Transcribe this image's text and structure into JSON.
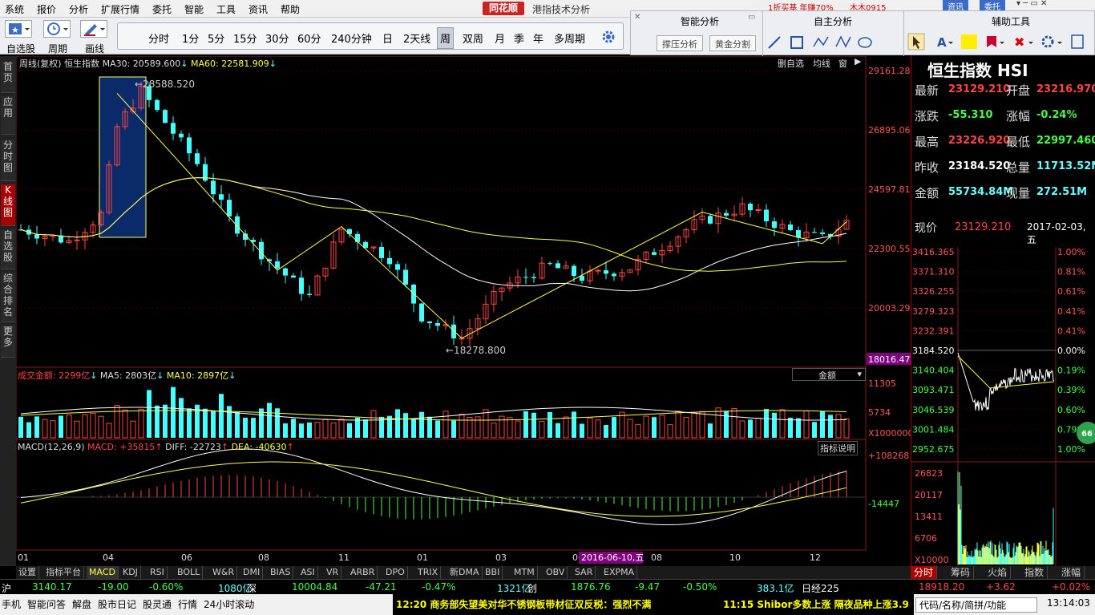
{
  "menu": [
    "系统",
    "报价",
    "分析",
    "扩展行情",
    "委托",
    "智能",
    "工具",
    "资讯",
    "帮助"
  ],
  "brand": "同花顺",
  "app_title": "港指技术分析",
  "top_right": {
    "ad": "1折买基 年赚70%",
    "user": "木木0915",
    "btn1": "资讯",
    "btn2": "委托"
  },
  "toolbar": {
    "btn_labels": [
      "自选股",
      "周期",
      "画线"
    ],
    "periods": [
      "分时",
      "1分",
      "5分",
      "15分",
      "30分",
      "60分",
      "240分钟",
      "日",
      "2天线",
      "周",
      "双周",
      "月",
      "季",
      "年",
      "多周期"
    ],
    "selected_period": "周"
  },
  "palettes": {
    "smart_title": "智能分析",
    "smart_btn1": "撑压分析",
    "smart_btn2": "黄金分割",
    "self_title": "自主分析",
    "aux_title": "辅助工具"
  },
  "leftnav": [
    "首页",
    "应用",
    "分时图",
    "K线图",
    "自选股",
    "综合排名",
    "更多"
  ],
  "main": {
    "hdr_period": "周线(复权)",
    "hdr_name": "恒生指数",
    "ma30": "MA30: 20589.600",
    "ma60": "MA60: 22581.909",
    "buttons": [
      "删自选",
      "均线",
      "窗"
    ],
    "price_axis": [
      "29161.28",
      "26895.06",
      "24597.81",
      "22300.55",
      "20003.29",
      "18016.47"
    ],
    "high_label": "28588.520",
    "low_label": "18278.800",
    "vol_hdr": "成交金额: 2299亿",
    "vol_ma5": "MA5: 2803亿",
    "vol_ma10": "MA10: 2897亿",
    "vol_select": "金额",
    "vol_axis": [
      "11305",
      "5734",
      "X1000000"
    ],
    "macd_hdr": "MACD(12,26,9)",
    "macd_val": "MACD: +35815",
    "diff": "DIFF: -22723",
    "dea": "DEA: -40630",
    "macd_btn": "指标说明",
    "macd_axis": [
      "+108268",
      "-14447"
    ],
    "x_axis": [
      "01",
      "04",
      "06",
      "08",
      "11",
      "01",
      "03",
      "06",
      "08",
      "10",
      "12"
    ],
    "cursor_date": "2016-06-10,五"
  },
  "idx_tabs": [
    "设置",
    "指标平台",
    "MACD",
    "KDJ",
    "RSI",
    "BOLL",
    "W&R",
    "DMI",
    "BIAS",
    "ASI",
    "VR",
    "ARBR",
    "DPO",
    "TRIX",
    "新DMA",
    "BBI",
    "MTM",
    "OBV",
    "SAR",
    "EXPMA"
  ],
  "idx_tab_active": "MACD",
  "panel": {
    "name": "恒生指数 HSI",
    "rows": [
      {
        "l1": "最新",
        "v1": "23129.210",
        "c1": "r",
        "l2": "开盘",
        "v2": "23216.970",
        "c2": "r"
      },
      {
        "l1": "涨跌",
        "v1": "-55.310",
        "c1": "g",
        "l2": "涨幅",
        "v2": "-0.24%",
        "c2": "g"
      },
      {
        "l1": "最高",
        "v1": "23226.920",
        "c1": "r",
        "l2": "最低",
        "v2": "22997.460",
        "c2": "g"
      },
      {
        "l1": "昨收",
        "v1": "23184.520",
        "c1": "w",
        "l2": "总量",
        "v2": "11713.52M",
        "c2": "c"
      },
      {
        "l1": "金额",
        "v1": "55734.84M",
        "c1": "c",
        "l2": "现量",
        "v2": "272.51M",
        "c2": "c"
      }
    ],
    "now_label": "现价",
    "now_val": "23129.210",
    "now_date": "2017-02-03,五",
    "mini_left": [
      "3416.365",
      "3371.310",
      "3326.255",
      "3279.323",
      "3232.391",
      "3184.520",
      "3140.404",
      "3093.471",
      "3046.539",
      "3001.484",
      "2952.675"
    ],
    "mini_right": [
      "1.00%",
      "0.81%",
      "0.61%",
      "0.41%",
      "0.41%",
      "0.00%",
      "0.19%",
      "0.39%",
      "0.60%",
      "0.79%",
      "1.00%"
    ],
    "mini_vol": [
      "26823",
      "20117",
      "13411",
      "6706",
      "X10000"
    ],
    "badge": "66",
    "tabs": [
      "分时",
      "筹码",
      "火焰",
      "指数",
      "涨幅"
    ]
  },
  "market": {
    "sh": "沪",
    "sh_v": "3140.17",
    "sh_c": "-19.00",
    "sh_p": "-0.60%",
    "sh_amt": "1080亿",
    "sz": "深",
    "sz_v": "10004.84",
    "sz_c": "-47.21",
    "sz_p": "-0.47%",
    "sz_amt": "1321亿",
    "cy": "创",
    "cy_v": "1876.76",
    "cy_c": "-9.47",
    "cy_p": "-0.50%",
    "cy_amt": "383.1亿",
    "rj": "日经225",
    "rj_v": "18918.20",
    "rj_c": "+3.62",
    "rj_p": "+0.02%"
  },
  "statusbar": {
    "items": [
      "手机",
      "智能问答",
      "解盘",
      "股市日记",
      "股灵通",
      "行情",
      "24小时滚动"
    ],
    "news1": "12:20 商务部失望美对华不锈钢板带材征双反税：强烈不满",
    "news2": "11:15 Shibor多数上涨 隔夜品种上涨3.9",
    "search": "代码/名称/简拼/功能",
    "time": "13:14:03"
  }
}
